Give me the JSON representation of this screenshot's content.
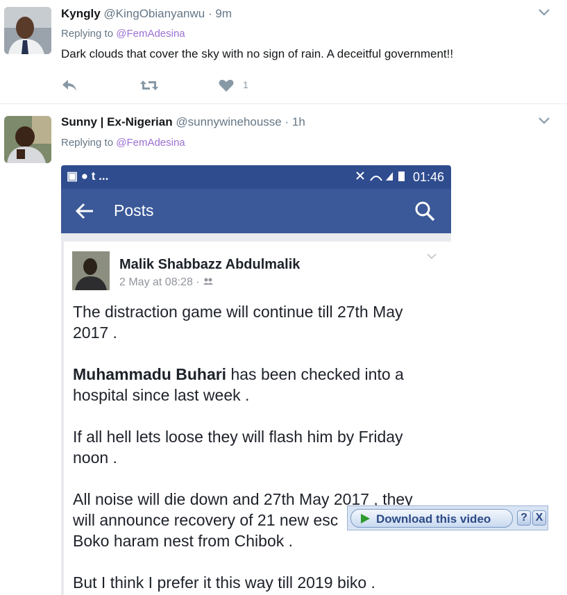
{
  "tweets": [
    {
      "display_name": "Kyngly",
      "handle": "@KingObianyanwu",
      "separator": "·",
      "time": "9m",
      "replying_prefix": "Replying to",
      "replying_to": "@FemAdesina",
      "text": "Dark clouds that cover the sky with no sign of rain. A deceitful government!!",
      "like_count": "1"
    },
    {
      "display_name": "Sunny | Ex-Nigerian",
      "handle": "@sunnywinehousse",
      "separator": "·",
      "time": "1h",
      "replying_prefix": "Replying to",
      "replying_to": "@FemAdesina"
    }
  ],
  "phone": {
    "status_left": "▣ ● t ...",
    "status_time": "01:46",
    "appbar_title": "Posts",
    "post": {
      "author": "Malik Shabbazz Abdulmalik",
      "meta": "2 May at 08:28 ·",
      "para1": "The distraction game will continue till 27th May 2017 .",
      "para2_bold": "Muhammadu Buhari",
      "para2_rest": " has been checked into a hospital since last week .",
      "para3": "If all hell lets loose they will flash him by Friday noon .",
      "para4": "All noise will die down and 27th May 2017 , they will announce recovery of 21 new esc",
      "para4_line3": "Boko haram nest from Chibok .",
      "para5": "But I think I prefer it this way till 2019 biko ."
    }
  },
  "overlay": {
    "download_label": "Download this video",
    "help_label": "?",
    "close_label": "X"
  },
  "colors": {
    "fb_blue": "#3b5998",
    "fb_status": "#2f4c8f",
    "link_purple": "#9b6fd1",
    "muted": "#657786"
  },
  "icons": [
    "reply-icon",
    "retweet-icon",
    "heart-icon",
    "chevron-down-icon",
    "back-arrow-icon",
    "search-icon",
    "play-icon"
  ]
}
